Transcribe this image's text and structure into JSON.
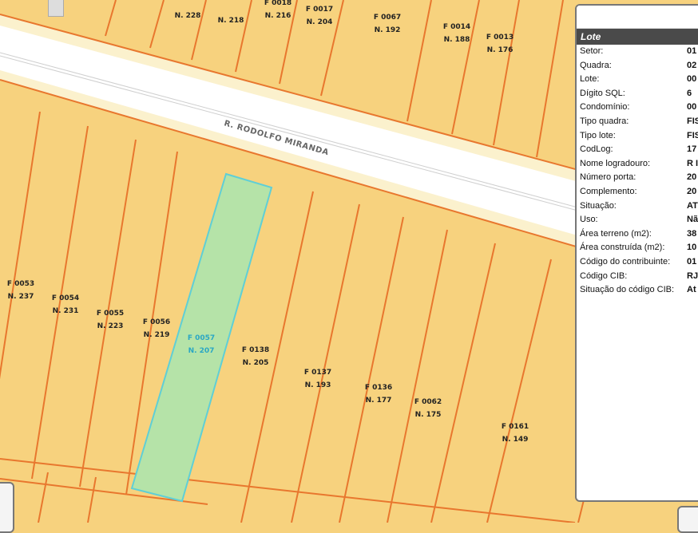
{
  "street": {
    "name": "R. RODOLFO MIRANDA"
  },
  "parcels": [
    {
      "id": "F 0018",
      "num": "N. 216"
    },
    {
      "id": "",
      "num": "N. 228"
    },
    {
      "id": "",
      "num": "N. 218"
    },
    {
      "id": "F 0017",
      "num": "N. 204"
    },
    {
      "id": "F 0067",
      "num": "N. 192"
    },
    {
      "id": "F 0014",
      "num": "N. 188"
    },
    {
      "id": "F 0013",
      "num": "N. 176"
    },
    {
      "id": "F 0053",
      "num": "N. 237"
    },
    {
      "id": "F 0054",
      "num": "N. 231"
    },
    {
      "id": "F 0055",
      "num": "N. 223"
    },
    {
      "id": "F 0056",
      "num": "N. 219"
    },
    {
      "id": "F 0057",
      "num": "N. 207",
      "selected": true
    },
    {
      "id": "F 0138",
      "num": "N. 205"
    },
    {
      "id": "F 0137",
      "num": "N. 193"
    },
    {
      "id": "F 0136",
      "num": "N. 177"
    },
    {
      "id": "F 0062",
      "num": "N. 175"
    },
    {
      "id": "F 0161",
      "num": "N. 149"
    }
  ],
  "panel": {
    "title": "Lote",
    "rows": [
      {
        "k": "Setor:",
        "v": "01"
      },
      {
        "k": "Quadra:",
        "v": "02"
      },
      {
        "k": "Lote:",
        "v": "00"
      },
      {
        "k": "Dígito SQL:",
        "v": "6"
      },
      {
        "k": "Condomínio:",
        "v": "00"
      },
      {
        "k": "Tipo quadra:",
        "v": "FIS"
      },
      {
        "k": "Tipo lote:",
        "v": "FIS"
      },
      {
        "k": "CodLog:",
        "v": "17"
      },
      {
        "k": "Nome logradouro:",
        "v": "R I"
      },
      {
        "k": "Número porta:",
        "v": "20"
      },
      {
        "k": "Complemento:",
        "v": "20"
      },
      {
        "k": "Situação:",
        "v": "AT"
      },
      {
        "k": "Uso:",
        "v": "Nã"
      },
      {
        "k": "Área terreno (m2):",
        "v": "38"
      },
      {
        "k": "Área construída (m2):",
        "v": "10"
      },
      {
        "k": "Código do contribuinte:",
        "v": "01"
      },
      {
        "k": "Código CIB:",
        "v": "RJ"
      },
      {
        "k": "Situação do código CIB:",
        "v": "At"
      }
    ]
  },
  "colors": {
    "parcel_fill": "#f7d27e",
    "parcel_line": "#e8772e",
    "selected_fill": "#b5e3a8",
    "selected_line": "#5fcfd6",
    "street_fill": "#ffffff"
  }
}
